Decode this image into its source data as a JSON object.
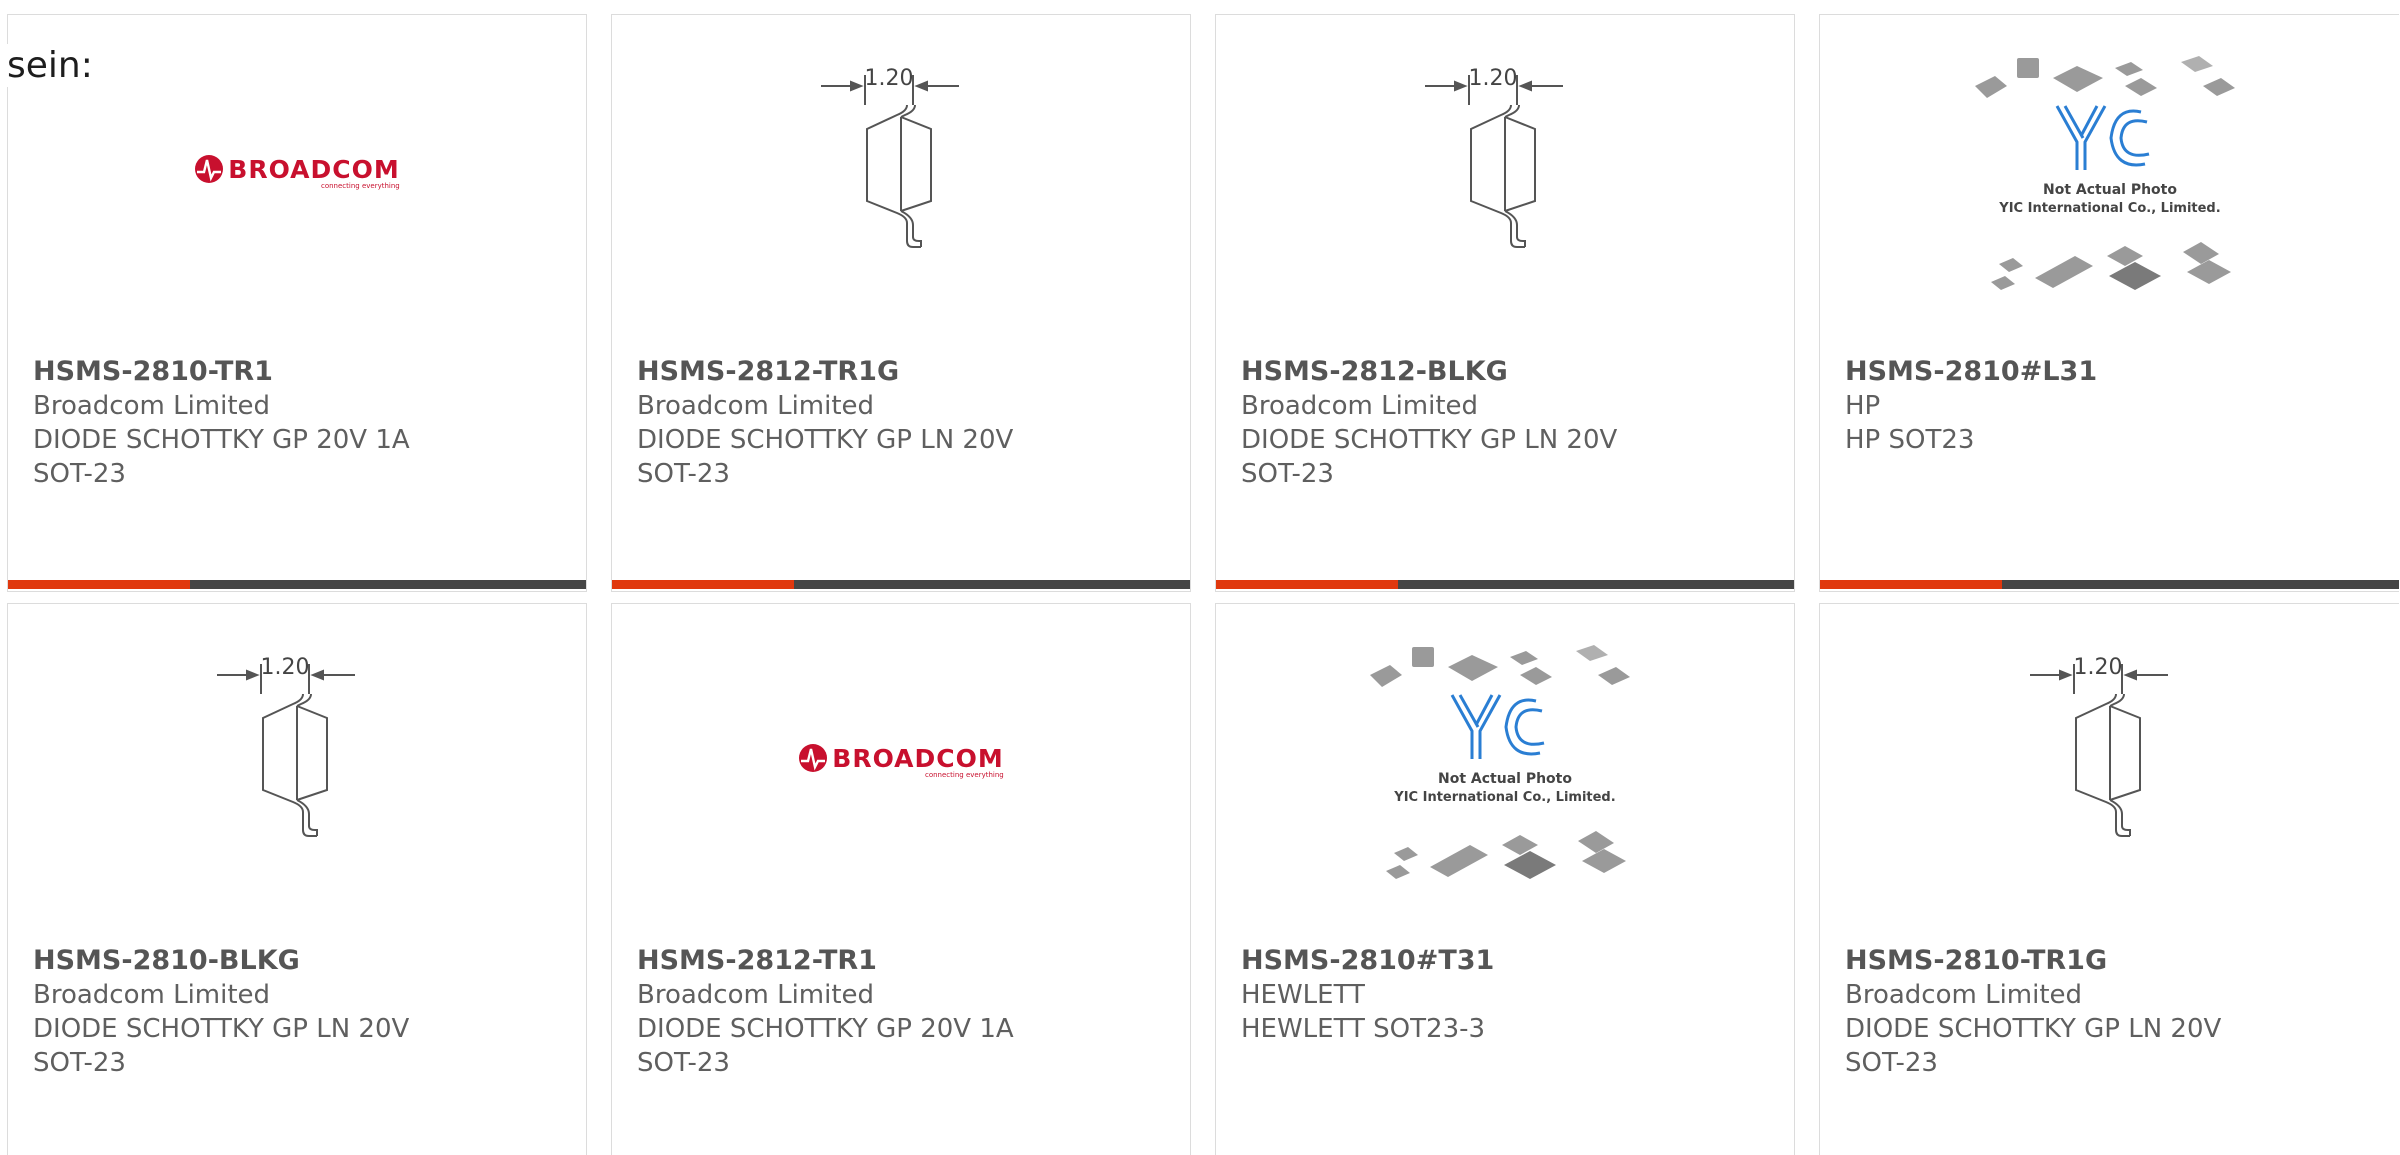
{
  "intro_text": "sein:",
  "colors": {
    "accent": "#e0380e",
    "bar": "#454545",
    "brand_red": "#c8102e",
    "yic_blue": "#2a7ed3"
  },
  "images": {
    "broadcom_logo": {
      "wordmark": "BROADCOM",
      "tagline": "connecting everything"
    },
    "dimension_drawing": {
      "dimension": "1.20"
    },
    "stock_photo": {
      "brand": "YIC",
      "line1": "Not Actual Photo",
      "line2": "YIC International Co., Limited."
    }
  },
  "products": [
    {
      "part_number": "HSMS-2810-TR1",
      "manufacturer": "Broadcom Limited",
      "description": "DIODE SCHOTTKY GP 20V 1A",
      "package": "SOT-23",
      "image": "broadcom-logo"
    },
    {
      "part_number": "HSMS-2812-TR1G",
      "manufacturer": "Broadcom Limited",
      "description": "DIODE SCHOTTKY GP LN 20V",
      "package": "SOT-23",
      "image": "sot23-dimension-drawing"
    },
    {
      "part_number": "HSMS-2812-BLKG",
      "manufacturer": "Broadcom Limited",
      "description": "DIODE SCHOTTKY GP LN 20V",
      "package": "SOT-23",
      "image": "sot23-dimension-drawing"
    },
    {
      "part_number": "HSMS-2810#L31",
      "manufacturer": "HP",
      "description": "HP SOT23",
      "package": "",
      "image": "yic-stock-photo"
    },
    {
      "part_number": "HSMS-2810-BLKG",
      "manufacturer": "Broadcom Limited",
      "description": "DIODE SCHOTTKY GP LN 20V",
      "package": "SOT-23",
      "image": "sot23-dimension-drawing"
    },
    {
      "part_number": "HSMS-2812-TR1",
      "manufacturer": "Broadcom Limited",
      "description": "DIODE SCHOTTKY GP 20V 1A",
      "package": "SOT-23",
      "image": "broadcom-logo"
    },
    {
      "part_number": "HSMS-2810#T31",
      "manufacturer": "HEWLETT",
      "description": "HEWLETT SOT23-3",
      "package": "",
      "image": "yic-stock-photo"
    },
    {
      "part_number": "HSMS-2810-TR1G",
      "manufacturer": "Broadcom Limited",
      "description": "DIODE SCHOTTKY GP LN 20V",
      "package": "SOT-23",
      "image": "sot23-dimension-drawing"
    }
  ]
}
